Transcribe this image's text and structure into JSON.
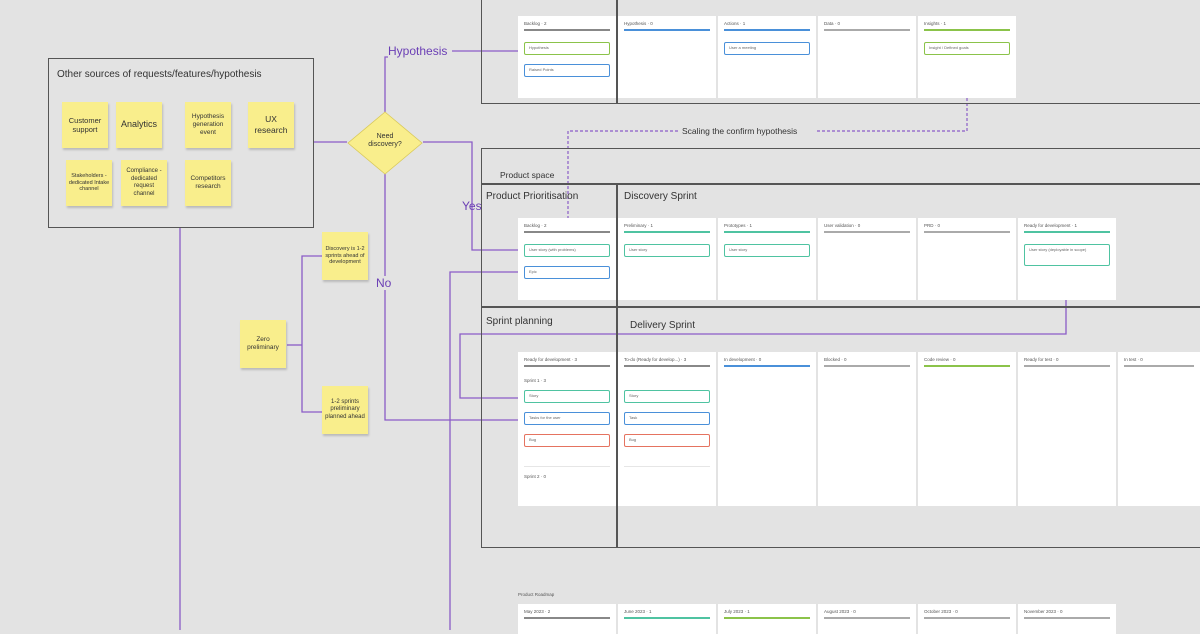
{
  "colors": {
    "line": "#8a5cc7",
    "sticky": "#f9ee8c",
    "frame": "#555555",
    "teal": "#4fc3a1",
    "blue": "#4a90d9",
    "green": "#8bc34a",
    "red": "#e57360"
  },
  "flow": {
    "hypothesis": "Hypothesis",
    "yes": "Yes",
    "no": "No",
    "scaling": "Scaling the confirm hypothesis",
    "need_discovery": "Need discovery?"
  },
  "sources": {
    "title": "Other sources of requests/features/hypothesis",
    "notes": [
      "Customer support",
      "Analytics",
      "Hypothesis generation event",
      "UX research",
      "Stakeholders - dedicated Intake channel",
      "Compliance - dedicated request channel",
      "Competitors research"
    ]
  },
  "side_notes": {
    "discovery": "Discovery is 1-2 sprints ahead of development",
    "zero_prelim": "Zero preliminary",
    "one_two": "1-2 sprints preliminary planned ahead"
  },
  "frames": {
    "product_space": "Product space",
    "product_prioritisation": "Product Prioritisation",
    "discovery_sprint": "Discovery Sprint",
    "sprint_planning": "Sprint planning",
    "delivery_sprint": "Delivery Sprint",
    "product_roadmap": "Product Roadmap"
  },
  "board_top": {
    "columns": [
      "Backlog · 2",
      "Hypothesis · 0",
      "Actions · 1",
      "Data · 0",
      "Insights · 1"
    ],
    "cards": [
      "Hypothesis",
      "Raised Points",
      "User a meeting",
      "Insight / Defined goals"
    ]
  },
  "board_mid": {
    "columns": [
      "Backlog · 2",
      "Preliminary · 1",
      "Prototypes · 1",
      "User validation · 0",
      "PRD · 0",
      "Ready for development · 1"
    ],
    "cards": [
      "User story (with problems)",
      "Epic",
      "User story",
      "User story",
      "User story (deployable in scope)"
    ]
  },
  "board_bot": {
    "columns": [
      "Ready for development · 3",
      "To-do (Ready for develop...) · 3",
      "In development · 0",
      "Blocked · 0",
      "Code review · 0",
      "Ready for test · 0",
      "In test · 0"
    ],
    "sprint1": "Sprint 1 · 3",
    "sprint2": "Sprint 2 · 0",
    "cards": [
      "Story",
      "Tasks for the user",
      "Bug",
      "Story",
      "Task",
      "Bug"
    ]
  },
  "roadmap": {
    "columns": [
      "May 2023 · 2",
      "June 2023 · 1",
      "July 2023 · 1",
      "August 2023 · 0",
      "October 2023 · 0",
      "November 2023 · 0"
    ]
  }
}
